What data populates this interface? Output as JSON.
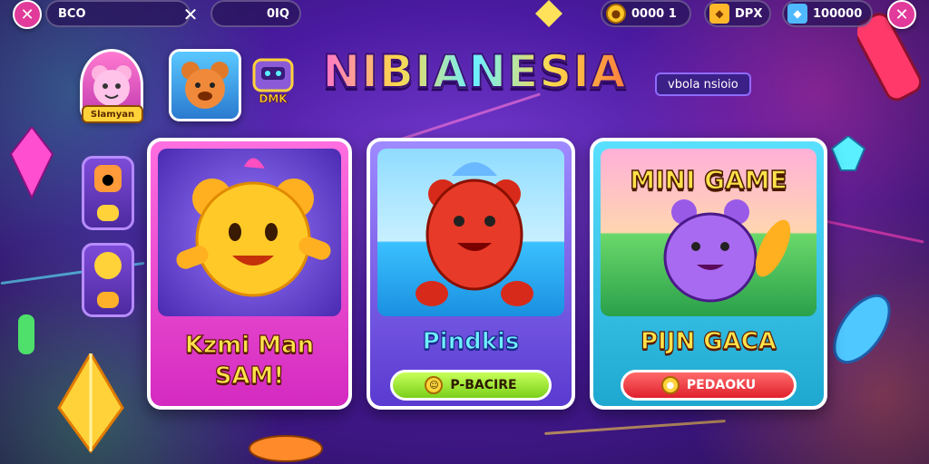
{
  "topbar": {
    "left_pill_label": "BCO",
    "second_pill_label": "0IQ",
    "resources": [
      {
        "icon": "coin-icon",
        "value": "0000 1"
      },
      {
        "icon": "shield-icon",
        "value": "DPX"
      },
      {
        "icon": "gem-icon",
        "value": "100000"
      }
    ]
  },
  "profile": {
    "avatar_label": "Slamyan",
    "badge_label": "DMK"
  },
  "title": {
    "text": "NIBIANESIA",
    "subtitle": "vbola nsioio"
  },
  "cards": [
    {
      "name_line1": "Kzmi Man",
      "name_line2": "SAM!",
      "accent": "#ff4fcf"
    },
    {
      "name_line1": "Pindkis",
      "cta_label": "P-BACIRE",
      "accent": "#6e58e8"
    },
    {
      "banner": "MINI GAME",
      "name_line1": "PIJN GACA",
      "cta_label": "PEDAOKU",
      "accent": "#32c8e0"
    }
  ],
  "colors": {
    "background": "#4a1aa0",
    "close_button": "#e13a9a",
    "green_button": "#9be23b",
    "red_button": "#ff3f4c"
  }
}
